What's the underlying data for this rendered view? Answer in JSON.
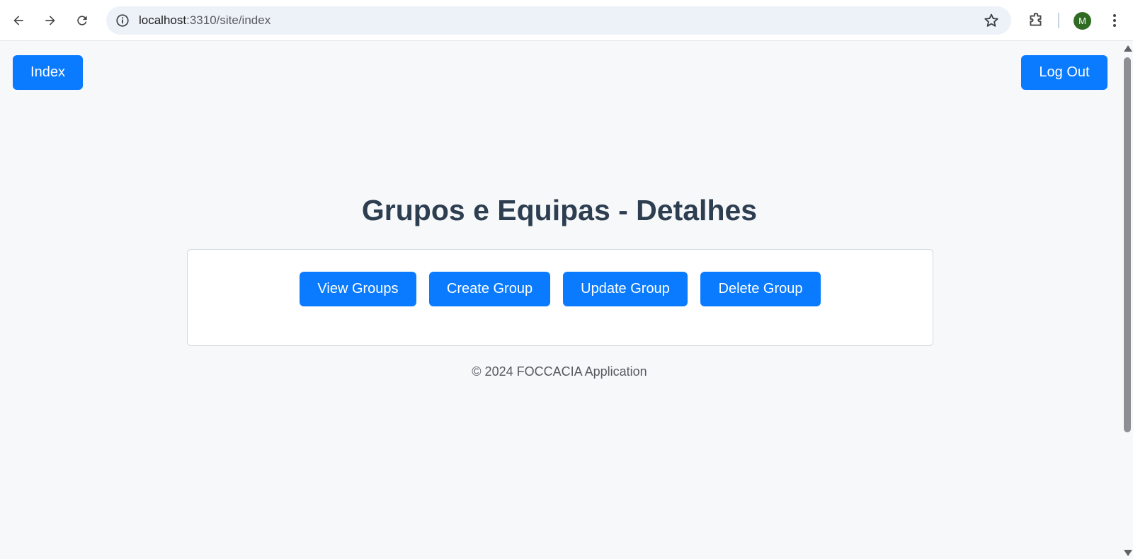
{
  "browser": {
    "url_host": "localhost",
    "url_rest": ":3310/site/index",
    "avatar_letter": "M",
    "icons": [
      "back-arrow-icon",
      "forward-arrow-icon",
      "reload-icon",
      "site-info-icon",
      "bookmark-star-icon",
      "extensions-icon",
      "more-menu-icon"
    ]
  },
  "header": {
    "index_label": "Index",
    "logout_label": "Log Out"
  },
  "main": {
    "title": "Grupos e Equipas - Detalhes",
    "actions": {
      "view": "View Groups",
      "create": "Create Group",
      "update": "Update Group",
      "delete": "Delete Group"
    }
  },
  "footer": {
    "text": "© 2024 FOCCACIA Application"
  },
  "colors": {
    "primary_button": "#0a7bff",
    "heading": "#2c3e50",
    "page_background": "#f7f8fa"
  }
}
